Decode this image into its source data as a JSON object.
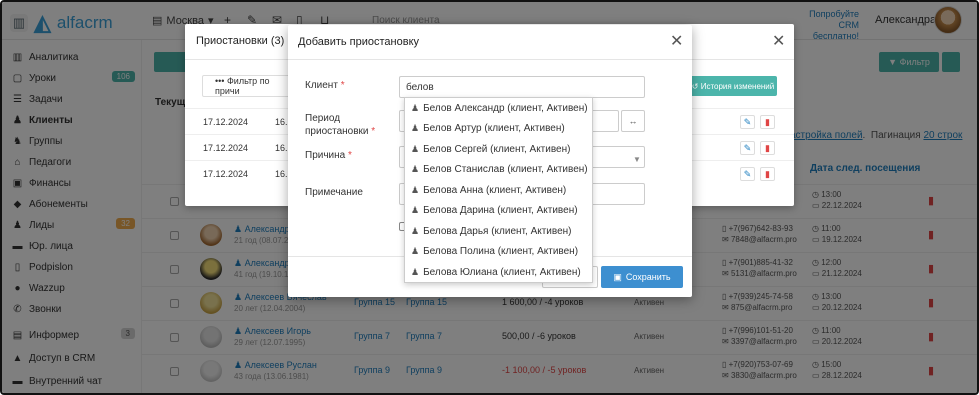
{
  "topbar": {
    "logo_text": "alfacrm",
    "branch": "Москва",
    "search_placeholder": "Поиск клиента",
    "promo": "Попробуйте CRM бесплатно!",
    "user_name": "Александра"
  },
  "sidebar": {
    "items": [
      {
        "label": "Аналитика",
        "icon": "chart-icon"
      },
      {
        "label": "Уроки",
        "icon": "calendar-icon",
        "badge": "106"
      },
      {
        "label": "Задачи",
        "icon": "tasks-icon"
      },
      {
        "label": "Клиенты",
        "icon": "user-icon",
        "active": true
      },
      {
        "label": "Группы",
        "icon": "group-icon"
      },
      {
        "label": "Педагоги",
        "icon": "graduation-icon"
      },
      {
        "label": "Финансы",
        "icon": "money-icon"
      },
      {
        "label": "Абонементы",
        "icon": "tag-icon"
      },
      {
        "label": "Лиды",
        "icon": "lead-icon",
        "badge": "32"
      },
      {
        "label": "Юр. лица",
        "icon": "briefcase-icon"
      },
      {
        "label": "Podpislon",
        "icon": "document-icon"
      },
      {
        "label": "Wazzup",
        "icon": "whatsapp-icon"
      },
      {
        "label": "Звонки",
        "icon": "phone-icon"
      },
      {
        "label": "Информер",
        "icon": "inbox-icon",
        "badge": "3"
      },
      {
        "label": "Доступ в CRM",
        "icon": "lock-icon"
      },
      {
        "label": "Внутренний чат",
        "icon": "chat-icon"
      }
    ],
    "badge_colors": {
      "green": "#4cb5ab",
      "orange": "#f0ad4e",
      "gray": "#d5d5d5"
    }
  },
  "main": {
    "filter_label": "Фильтр",
    "tekush": "Текущ",
    "settings_text": "астройка полей",
    "pagination_text": "Пагинация",
    "pagination_value": "20 строк",
    "col_next_visit": "Дата след. посещения",
    "rows": [
      {
        "name": "",
        "sub": "",
        "grp1": "",
        "grp2": "",
        "bal": "",
        "stat": "",
        "phone": "",
        "email": "",
        "time": "13:00",
        "date": "22.12.2024"
      },
      {
        "name": "Александр",
        "sub": "21 год (08.07.2",
        "grp1": "",
        "grp2": "",
        "bal": "",
        "stat": "",
        "phone": "+7(967)642-83-93",
        "email": "7848@alfacrm.pro",
        "time": "11:00",
        "date": "19.12.2024"
      },
      {
        "name": "Александр",
        "sub": "41 год (19.10.19",
        "grp1": "",
        "grp2": "",
        "bal": "",
        "stat": "",
        "phone": "+7(901)885-41-32",
        "email": "5131@alfacrm.pro",
        "time": "12:00",
        "date": "21.12.2024"
      },
      {
        "name": "Алексеев Вячеслав",
        "sub": "20 лет (12.04.2004)",
        "grp1": "Группа 15",
        "grp2": "Группа 15",
        "bal": "1 600,00 / -4 уроков",
        "stat": "Активен",
        "phone": "+7(939)245-74-58",
        "email": "875@alfacrm.pro",
        "time": "13:00",
        "date": "20.12.2024"
      },
      {
        "name": "Алексеев Игорь",
        "sub": "29 лет (12.07.1995)",
        "grp1": "Группа 7",
        "grp2": "Группа 7",
        "bal": "500,00 / -6 уроков",
        "stat": "Активен",
        "phone": "+7(996)101-51-20",
        "email": "3397@alfacrm.pro",
        "time": "11:00",
        "date": "20.12.2024"
      },
      {
        "name": "Алексеев Руслан",
        "sub": "43 года (13.06.1981)",
        "grp1": "Группа 9",
        "grp2": "Группа 9",
        "bal": "-1 100,00 / -5 уроков",
        "stat": "Активен",
        "phone": "+7(920)753-07-69",
        "email": "3830@alfacrm.pro",
        "time": "15:00",
        "date": "28.12.2024"
      }
    ]
  },
  "modal_suspensions": {
    "title": "Приостановки (3)",
    "filter_btn": "••• Фильтр по причи",
    "history_btn": "История изменений",
    "rows": [
      {
        "d1": "17.12.2024",
        "d2": "16."
      },
      {
        "d1": "17.12.2024",
        "d2": "16."
      },
      {
        "d1": "17.12.2024",
        "d2": "16."
      }
    ]
  },
  "modal_add": {
    "title": "Добавить приостановку",
    "client_label": "Клиент",
    "client_value": "белов",
    "period_label": "Период приостановки",
    "reason_label": "Причина",
    "note_label": "Примечание",
    "save_btn": "Сохранить"
  },
  "autocomplete": [
    "Белов Александр (клиент, Активен)",
    "Белов Артур (клиент, Активен)",
    "Белов Сергей (клиент, Активен)",
    "Белов Станислав (клиент, Активен)",
    "Белова Анна (клиент, Активен)",
    "Белова Дарина (клиент, Активен)",
    "Белова Дарья (клиент, Активен)",
    "Белова Полина (клиент, Активен)",
    "Белова Юлиана (клиент, Активен)"
  ]
}
